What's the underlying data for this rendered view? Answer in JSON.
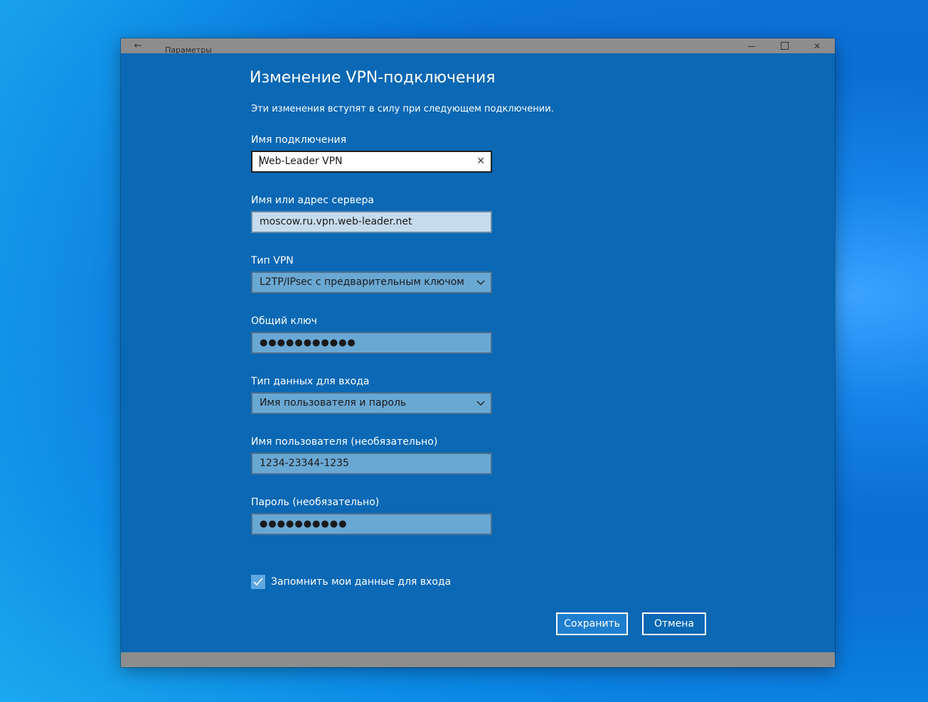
{
  "window": {
    "title": "Параметры",
    "back_glyph": "←",
    "close_glyph": "✕"
  },
  "form": {
    "heading": "Изменение VPN-подключения",
    "subtext": "Эти изменения вступят в силу при следующем подключении.",
    "connection_name": {
      "label": "Имя подключения",
      "value": "Web-Leader VPN",
      "clear_glyph": "✕"
    },
    "server": {
      "label": "Имя или адрес сервера",
      "value": "moscow.ru.vpn.web-leader.net"
    },
    "vpn_type": {
      "label": "Тип VPN",
      "value": "L2TP/IPsec с предварительным ключом"
    },
    "preshared_key": {
      "label": "Общий ключ",
      "value": "●●●●●●●●●●●"
    },
    "signin_type": {
      "label": "Тип данных для входа",
      "value": "Имя пользователя и пароль"
    },
    "username": {
      "label": "Имя пользователя (необязательно)",
      "value": "1234-23344-1235"
    },
    "password": {
      "label": "Пароль (необязательно)",
      "value": "●●●●●●●●●●"
    },
    "remember": {
      "label": "Запомнить мои данные для входа",
      "checked": true
    },
    "buttons": {
      "save": "Сохранить",
      "cancel": "Отмена"
    }
  },
  "colors": {
    "content_bg": "#0a68b4",
    "frame": "#8d8d8d",
    "checkbox": "#5ea7e0"
  }
}
